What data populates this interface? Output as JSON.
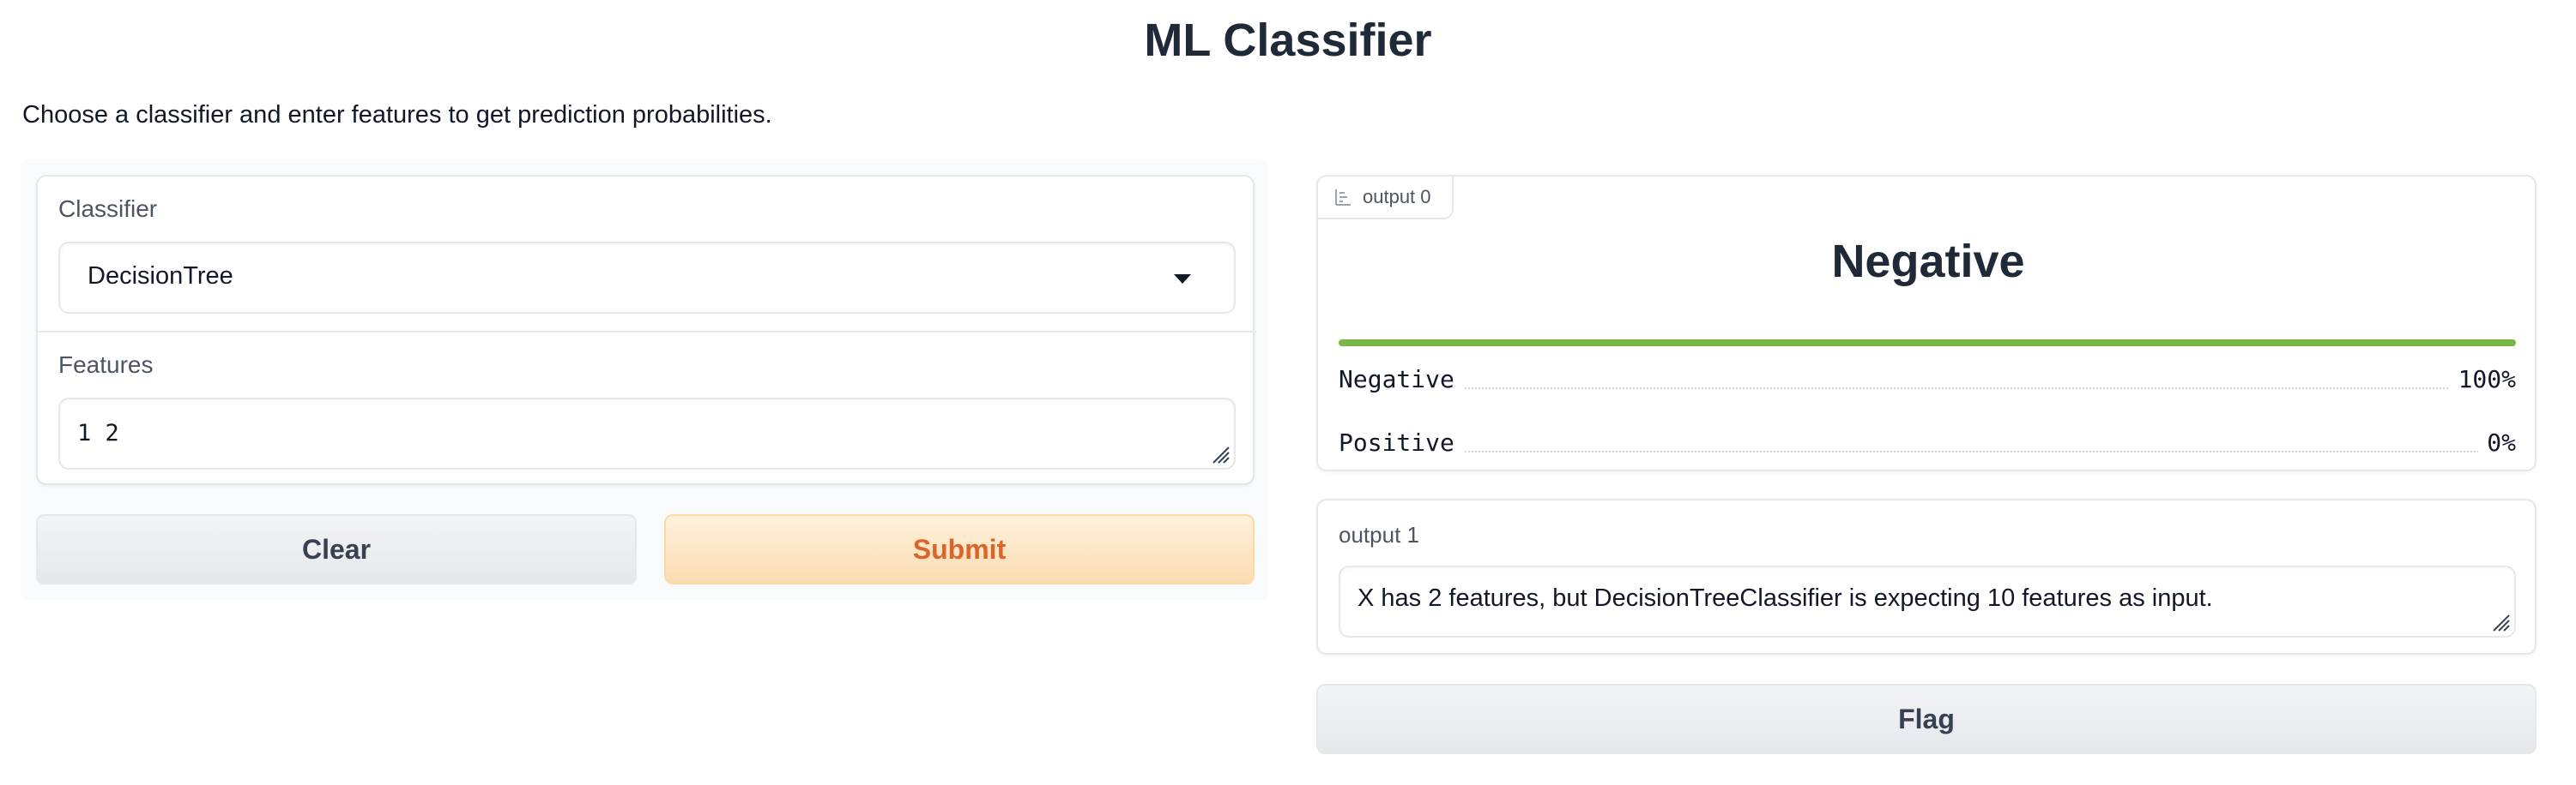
{
  "page": {
    "title": "ML Classifier",
    "description": "Choose a classifier and enter features to get prediction probabilities."
  },
  "inputs": {
    "classifier": {
      "label": "Classifier",
      "selected": "DecisionTree"
    },
    "features": {
      "label": "Features",
      "value": "1 2"
    }
  },
  "buttons": {
    "clear": "Clear",
    "submit": "Submit",
    "flag": "Flag"
  },
  "outputs": {
    "label_output": {
      "tab": "output 0",
      "predicted": "Negative",
      "top_confidence": 1.0,
      "confidences": [
        {
          "label": "Negative",
          "pct": "100%",
          "value": 1.0
        },
        {
          "label": "Positive",
          "pct": "0%",
          "value": 0.0
        }
      ]
    },
    "text_output": {
      "label": "output 1",
      "value": "X has 2 features, but DecisionTreeClassifier is expecting 10 features as input."
    }
  },
  "colors": {
    "primary_text": "#d9652a",
    "confidence_bar": "#7ab648"
  },
  "icons": {
    "output_tab": "bar-chart-icon",
    "dropdown": "caret-down-icon",
    "textarea": "resize-handle-icon"
  }
}
